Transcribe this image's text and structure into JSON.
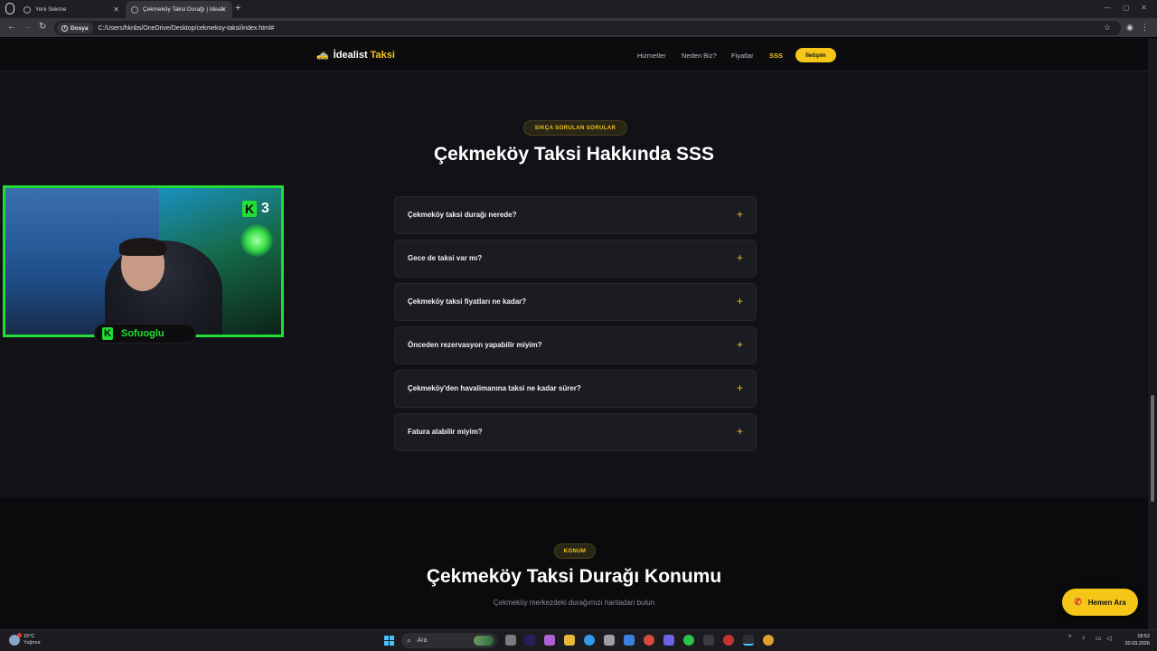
{
  "browser": {
    "tabs": [
      {
        "title": "Yeni Sekme",
        "active": false
      },
      {
        "title": "Çekmeköy Taksi Durağı | İdealis",
        "active": true
      }
    ],
    "new_tab_icon": "plus-icon",
    "address": {
      "security_label": "Dosya",
      "url": "C:/Users/hknbs/OneDrive/Desktop/cekmekoy-taksi/index.html#"
    }
  },
  "site": {
    "logo": {
      "word1": "İdealist",
      "word2": "Taksi",
      "icon": "taxi-car-icon"
    },
    "nav": {
      "links": [
        "Hizmetler",
        "Neden Biz?",
        "Fiyatlar",
        "SSS"
      ],
      "active": "SSS",
      "cta": "İletişim"
    },
    "faq": {
      "badge": "SIKÇA SORULAN SORULAR",
      "title": "Çekmeköy Taksi Hakkında SSS",
      "items": [
        {
          "question": "Çekmeköy taksi durağı nerede?",
          "icon": "+"
        },
        {
          "question": "Gece de taksi var mı?",
          "icon": "+"
        },
        {
          "question": "Çekmeköy taksi fiyatları ne kadar?",
          "icon": "+"
        },
        {
          "question": "Önceden rezervasyon yapabilir miyim?",
          "icon": "+"
        },
        {
          "question": "Çekmeköy'den havalimanına taksi ne kadar sürer?",
          "icon": "+"
        },
        {
          "question": "Fatura alabilir miyim?",
          "icon": "+"
        }
      ]
    },
    "location": {
      "badge": "KONUM",
      "title": "Çekmeköy Taksi Durağı Konumu",
      "subtitle": "Çekmeköy merkezdeki durağımızı haritadan bulun"
    },
    "call_button": {
      "label": "Hemen Ara",
      "icon": "phone-icon"
    },
    "accent_color": "#f5c518"
  },
  "webcam_overlay": {
    "badge_letter": "K",
    "badge_number": "3",
    "name_letter": "K",
    "name": "Sofuoglu",
    "frame_color": "#22dd33"
  },
  "taskbar": {
    "weather": {
      "temp": "15°C",
      "condition": "Yağmur"
    },
    "search_placeholder": "Ara",
    "clock": {
      "time": "18:52",
      "date": "20.03.2026"
    }
  }
}
